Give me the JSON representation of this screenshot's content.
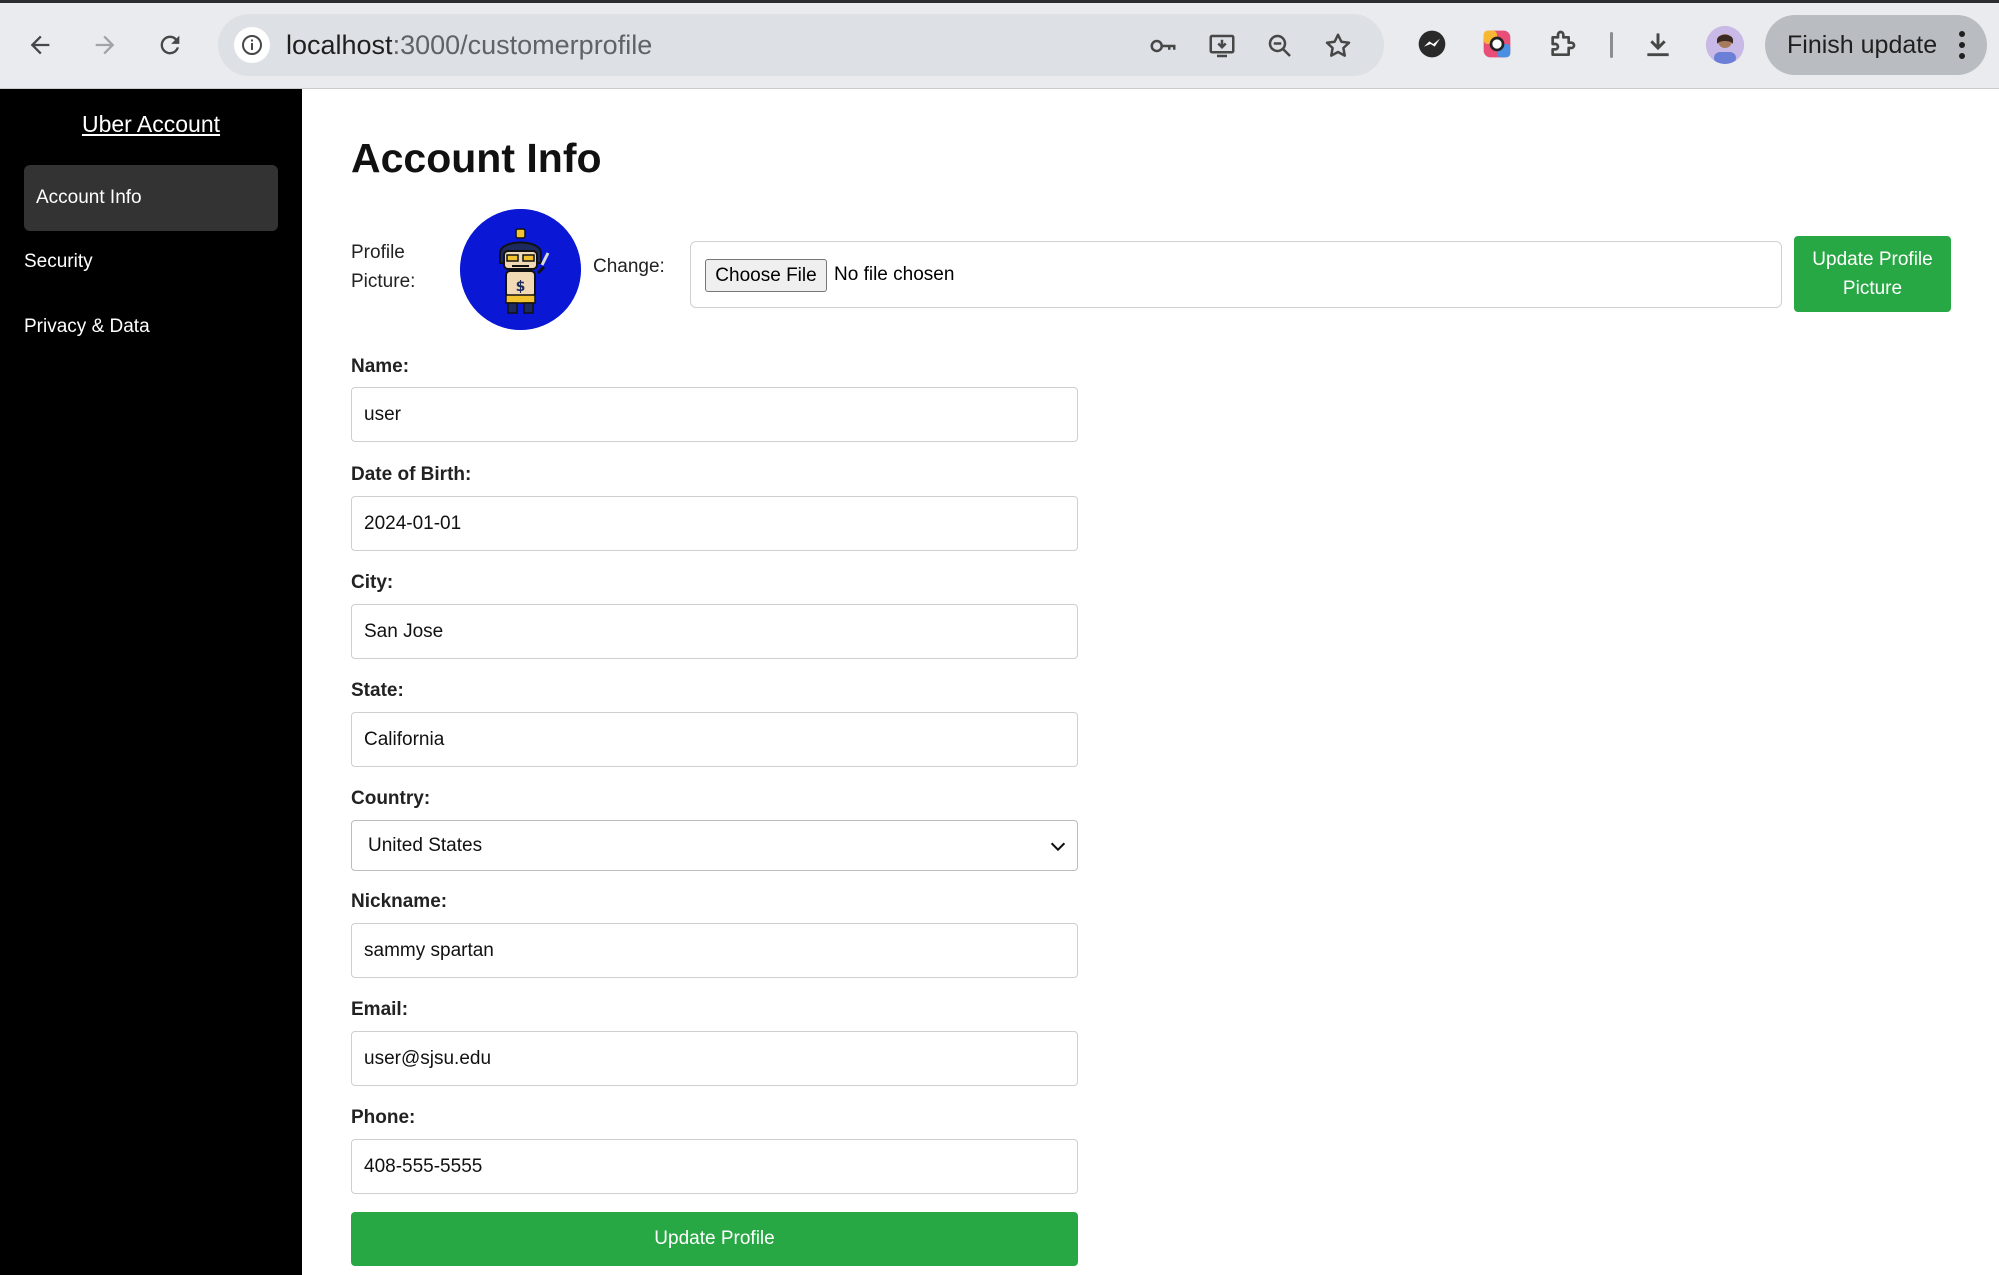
{
  "browser": {
    "url_host": "localhost",
    "url_path": ":3000/customerprofile",
    "finish_update_label": "Finish update"
  },
  "sidebar": {
    "title": "Uber Account",
    "items": [
      {
        "label": "Account Info",
        "active": true
      },
      {
        "label": "Security",
        "active": false
      },
      {
        "label": "Privacy & Data",
        "active": false
      }
    ]
  },
  "main": {
    "title": "Account Info",
    "profile_picture_label": "Profile Picture:",
    "change_label": "Change:",
    "choose_file_label": "Choose File",
    "no_file_text": "No file chosen",
    "update_picture_label": "Update Profile Picture",
    "fields": {
      "name": {
        "label": "Name:",
        "value": "user"
      },
      "dob": {
        "label": "Date of Birth:",
        "value": "2024-01-01"
      },
      "city": {
        "label": "City:",
        "value": "San Jose"
      },
      "state": {
        "label": "State:",
        "value": "California"
      },
      "country": {
        "label": "Country:",
        "value": "United States"
      },
      "nickname": {
        "label": "Nickname:",
        "value": "sammy spartan"
      },
      "email": {
        "label": "Email:",
        "value": "user@sjsu.edu"
      },
      "phone": {
        "label": "Phone:",
        "value": "408-555-5555"
      }
    },
    "update_profile_label": "Update Profile"
  },
  "colors": {
    "accent_green": "#28a745",
    "sidebar_bg": "#000000",
    "avatar_bg": "#0a18d6"
  },
  "icons": [
    "back-arrow-icon",
    "forward-arrow-icon",
    "reload-icon",
    "site-info-icon",
    "key-icon",
    "install-app-icon",
    "zoom-icon",
    "bookmark-star-icon",
    "messenger-icon",
    "color-extension-icon",
    "extensions-puzzle-icon",
    "download-icon",
    "profile-avatar",
    "more-menu-icon"
  ]
}
